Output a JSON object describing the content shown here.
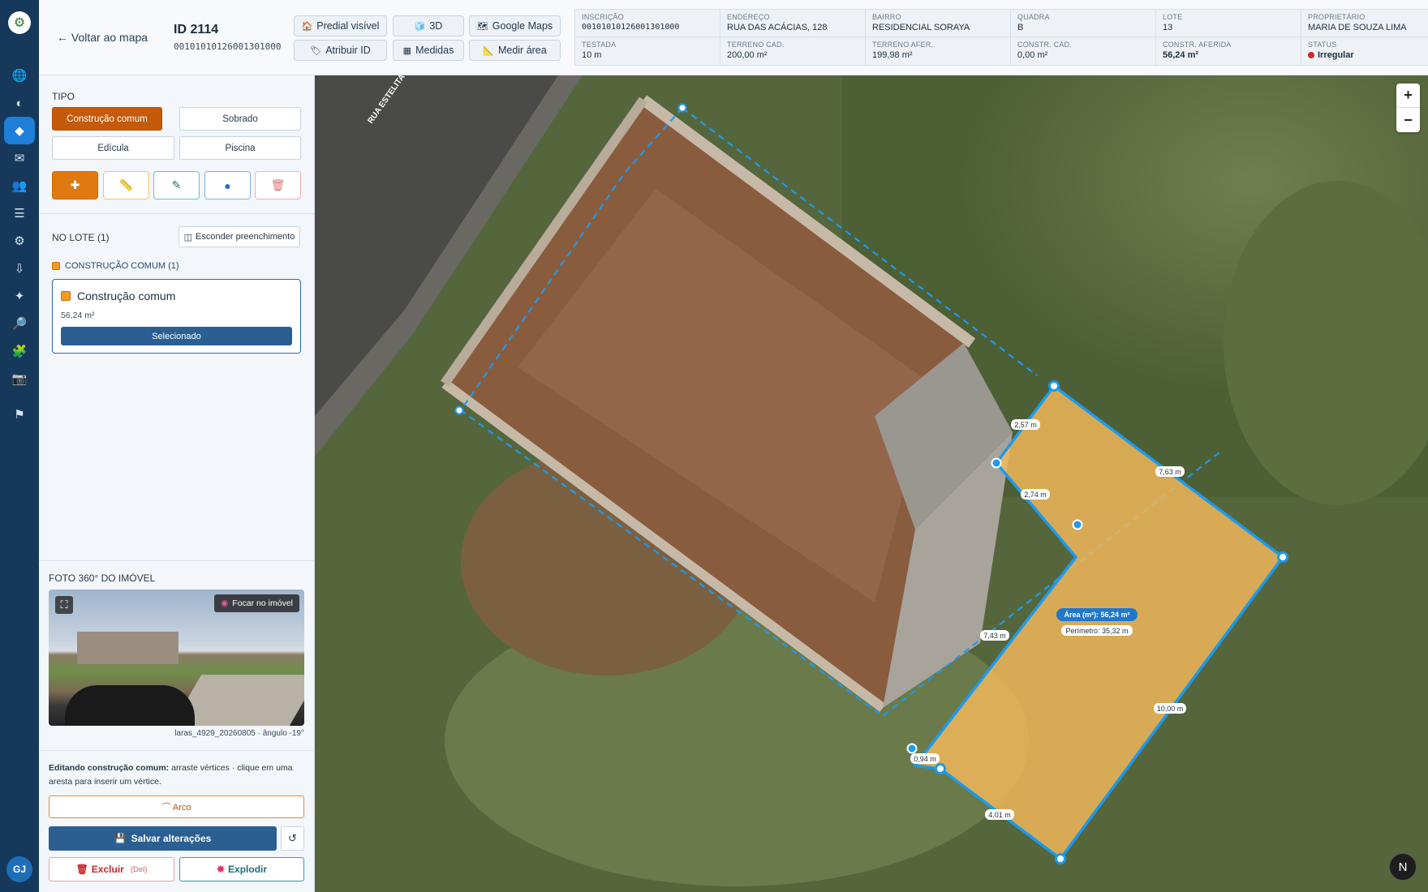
{
  "topbar": {
    "back_label": "← Voltar ao mapa",
    "id_title": "ID 2114",
    "id_code": "00101010126001301000",
    "buttons": {
      "predial": "Predial visível",
      "three_d": "3D",
      "google_maps": "Google Maps",
      "atribuir": "Atribuir ID",
      "medidas": "Medidas",
      "medir_area": "Medir área"
    }
  },
  "info": {
    "inscricao": {
      "label": "INSCRIÇÃO",
      "value": "00101010126001301000"
    },
    "endereco": {
      "label": "ENDEREÇO",
      "value": "RUA DAS ACÁCIAS, 128"
    },
    "bairro": {
      "label": "BAIRRO",
      "value": "RESIDENCIAL SORAYA"
    },
    "quadra": {
      "label": "QUADRA",
      "value": "B"
    },
    "lote": {
      "label": "LOTE",
      "value": "13"
    },
    "proprietario": {
      "label": "PROPRIETÁRIO",
      "value": "MARIA DE SOUZA LIMA"
    },
    "testada": {
      "label": "TESTADA",
      "value": "10 m"
    },
    "terreno_cad": {
      "label": "TERRENO CAD.",
      "value": "200,00 m²"
    },
    "terreno_afer": {
      "label": "TERRENO AFER.",
      "value": "199,98 m²"
    },
    "constr_cad": {
      "label": "CONSTR. CAD.",
      "value": "0,00 m²"
    },
    "constr_aferida": {
      "label": "CONSTR. AFERIDA",
      "value": "56,24 m²"
    },
    "status": {
      "label": "STATUS",
      "value": "Irregular",
      "color": "#d8282f"
    }
  },
  "panel": {
    "tipo_heading": "TIPO",
    "types": [
      "Construção comum",
      "Sobrado",
      "Edícula",
      "Piscina"
    ],
    "selected_type": "Construção comum",
    "tools": [
      {
        "icon": "plus-icon",
        "glyph": "✚"
      },
      {
        "icon": "ruler-icon",
        "glyph": "📏"
      },
      {
        "icon": "pencil-icon",
        "glyph": "✎"
      },
      {
        "icon": "circle-icon",
        "glyph": "●"
      },
      {
        "icon": "trash-icon",
        "glyph": "🗑"
      }
    ],
    "nolote_heading": "NO LOTE (1)",
    "hide_fill_label": "Esconder preenchimento",
    "category_label": "CONSTRUÇÃO COMUM (1)",
    "card": {
      "title": "Construção comum",
      "area": "56,24 m²",
      "selected_label": "Selecionado"
    },
    "foto_heading": "FOTO 360° DO IMÓVEL",
    "focar_label": "Focar no imóvel",
    "photo_caption": "laras_4929_20260805 · ângulo -19°",
    "edit_note_bold": "Editando construção comum:",
    "edit_note_rest": " arraste vértices · clique em uma aresta para inserir um vértice.",
    "arco_label": "⌒ Arco",
    "save_label": "Salvar alterações",
    "undo_glyph": "↺",
    "delete_label": "Excluir",
    "delete_key": "(Del)",
    "explode_label": "Explodir"
  },
  "map": {
    "street_label": "RUA ESTELITA",
    "area_label": "Área (m²): 56,24 m²",
    "perimeter_label": "Perímetro: 35,32 m",
    "edge_labels": [
      "2,57 m",
      "7,63 m",
      "2,74 m",
      "7,43 m",
      "10,00 m",
      "0,94 m",
      "4,01 m"
    ],
    "compass": "N",
    "polygon_color": "#f5b95a",
    "edge_color": "#1a9bf0"
  },
  "user": {
    "initials": "GJ"
  }
}
